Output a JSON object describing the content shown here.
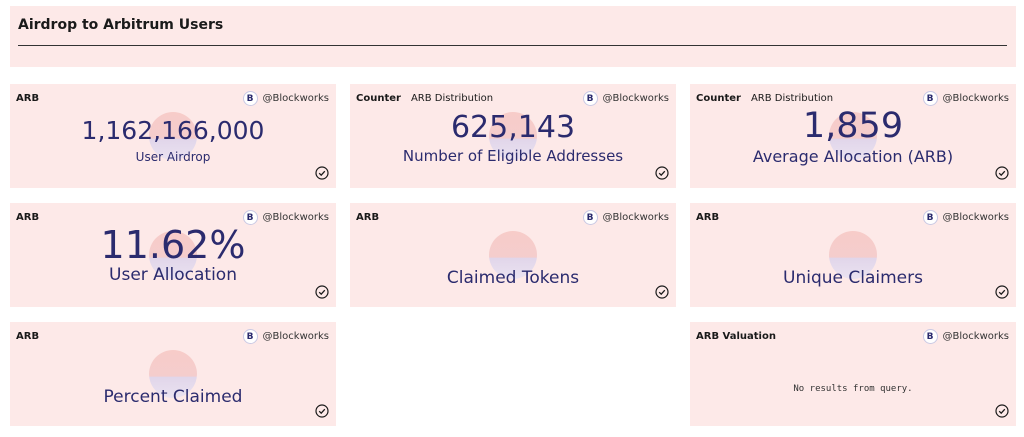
{
  "header": {
    "title": "Airdrop to Arbitrum Users"
  },
  "brand": {
    "handle": "@Blockworks",
    "logo_letter": "B",
    "accent": "#2b2b6e",
    "card_bg": "#fde9e8"
  },
  "cards": [
    {
      "query": "ARB",
      "type": "",
      "value": "1,162,166,000",
      "label": "User Airdrop"
    },
    {
      "query": "Counter",
      "type": "ARB Distribution",
      "value": "625,143",
      "label": "Number of Eligible Addresses"
    },
    {
      "query": "Counter",
      "type": "ARB Distribution",
      "value": "1,859",
      "label": "Average Allocation (ARB)"
    },
    {
      "query": "ARB",
      "type": "",
      "value": "11.62%",
      "label": "User Allocation"
    },
    {
      "query": "ARB",
      "type": "",
      "value": "",
      "label": "Claimed Tokens"
    },
    {
      "query": "ARB",
      "type": "",
      "value": "",
      "label": "Unique Claimers"
    },
    {
      "query": "ARB",
      "type": "",
      "value": "",
      "label": "Percent Claimed"
    },
    {
      "query": "ARB Valuation",
      "type": "",
      "value": "",
      "label": "",
      "message": "No results from query."
    }
  ]
}
